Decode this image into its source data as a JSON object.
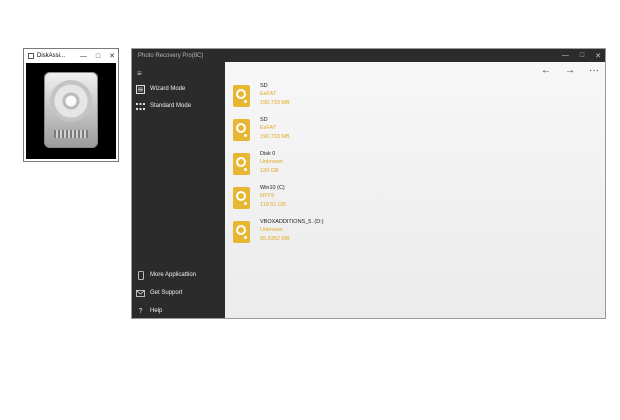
{
  "small_window": {
    "title": "DiskAssi...",
    "min": "—",
    "max": "□",
    "close": "✕"
  },
  "main_window": {
    "title": "Photo Recovery Pro(8C)",
    "min": "—",
    "max": "□",
    "close": "✕"
  },
  "sidebar": {
    "menu_icon": "≡",
    "items": [
      {
        "label": "Wizard Mode",
        "icon": "wizard-icon"
      },
      {
        "label": "Standard Mode",
        "icon": "grid-icon"
      },
      {
        "label": "More Applicattion",
        "icon": "phone-icon"
      },
      {
        "label": "Get Support",
        "icon": "mail-icon"
      },
      {
        "label": "Help",
        "icon": "help-icon"
      }
    ]
  },
  "toolbar": {
    "back": "←",
    "forward": "→",
    "more": "···"
  },
  "drives": [
    {
      "name": "SD",
      "fs": "ExFAT",
      "size": "190.733 MB"
    },
    {
      "name": "SD",
      "fs": "ExFAT",
      "size": "190.733 MB"
    },
    {
      "name": "Disk 0",
      "fs": "Unknown",
      "size": "120 GB"
    },
    {
      "name": "Win10 (C)",
      "fs": "NTFS",
      "size": "119.51 GB"
    },
    {
      "name": "VBOXADDITIONS_5. (D:)",
      "fs": "Unknown",
      "size": "55.5352 MB"
    }
  ],
  "colors": {
    "sidebar_bg": "#2b2b2b",
    "accent_orange": "#e3a821",
    "drive_icon": "#e7b633"
  }
}
